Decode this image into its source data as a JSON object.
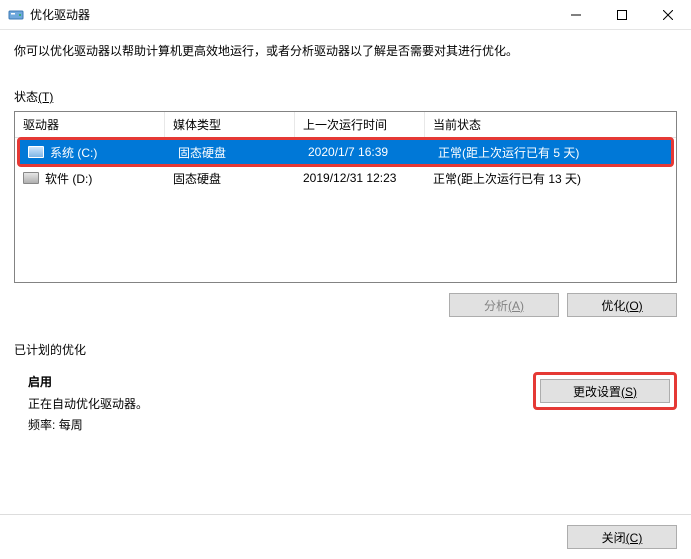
{
  "window": {
    "title": "优化驱动器"
  },
  "content": {
    "description": "你可以优化驱动器以帮助计算机更高效地运行，或者分析驱动器以了解是否需要对其进行优化。",
    "status_label": "状态",
    "status_hotkey": "(T)"
  },
  "table": {
    "headers": {
      "drive": "驱动器",
      "media": "媒体类型",
      "last_run": "上一次运行时间",
      "status": "当前状态"
    },
    "rows": [
      {
        "drive": "系统 (C:)",
        "media": "固态硬盘",
        "last_run": "2020/1/7 16:39",
        "status": "正常(距上次运行已有 5 天)",
        "selected": true
      },
      {
        "drive": "软件 (D:)",
        "media": "固态硬盘",
        "last_run": "2019/12/31 12:23",
        "status": "正常(距上次运行已有 13 天)",
        "selected": false
      }
    ]
  },
  "buttons": {
    "analyze": "分析",
    "analyze_hotkey": "(A)",
    "optimize": "优化",
    "optimize_hotkey": "(O)",
    "change_settings": "更改设置",
    "change_settings_hotkey": "(S)",
    "close": "关闭",
    "close_hotkey": "(C)"
  },
  "schedule": {
    "title": "已计划的优化",
    "enabled": "启用",
    "description": "正在自动优化驱动器。",
    "frequency_label": "频率:",
    "frequency_value": "每周"
  }
}
